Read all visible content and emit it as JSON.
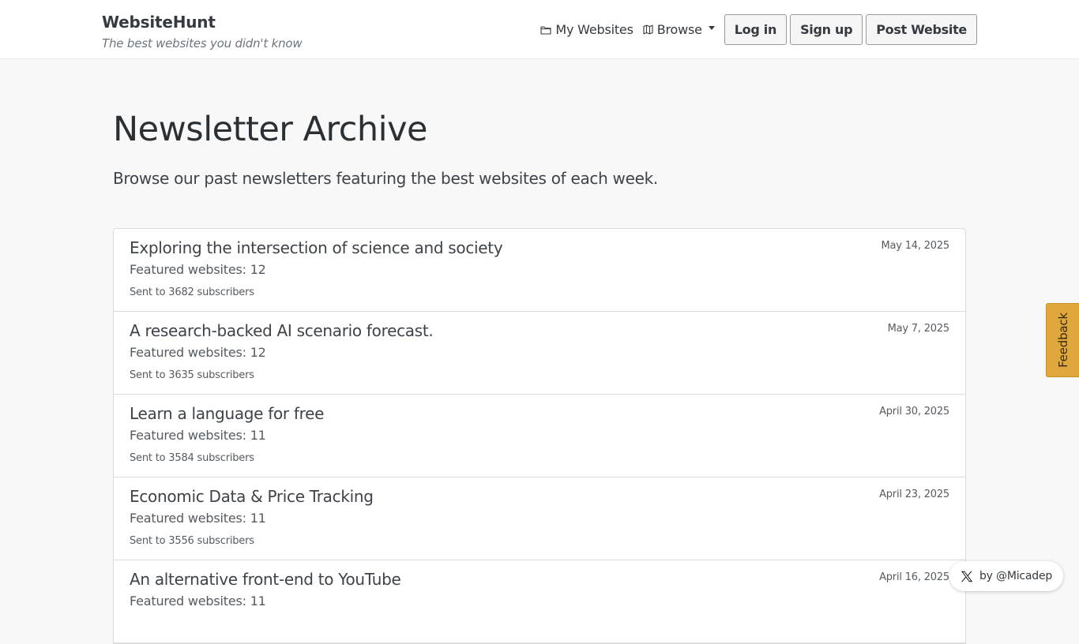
{
  "header": {
    "brand_title": "WebsiteHunt",
    "brand_tagline": "The best websites you didn't know",
    "nav": {
      "my_websites": "My Websites",
      "browse": "Browse"
    },
    "buttons": {
      "login": "Log in",
      "signup": "Sign up",
      "post_website": "Post Website"
    }
  },
  "main": {
    "title": "Newsletter Archive",
    "lead": "Browse our past newsletters featuring the best websites of each week.",
    "newsletters": [
      {
        "title": "Exploring the intersection of science and society",
        "featured": "Featured websites: 12",
        "subscribers": "Sent to 3682 subscribers",
        "date": "May 14, 2025"
      },
      {
        "title": "A research-backed AI scenario forecast.",
        "featured": "Featured websites: 12",
        "subscribers": "Sent to 3635 subscribers",
        "date": "May 7, 2025"
      },
      {
        "title": "Learn a language for free",
        "featured": "Featured websites: 11",
        "subscribers": "Sent to 3584 subscribers",
        "date": "April 30, 2025"
      },
      {
        "title": "Economic Data & Price Tracking",
        "featured": "Featured websites: 11",
        "subscribers": "Sent to 3556 subscribers",
        "date": "April 23, 2025"
      },
      {
        "title": "An alternative front-end to YouTube",
        "featured": "Featured websites: 11",
        "subscribers": "",
        "date": "April 16, 2025"
      }
    ]
  },
  "feedback": {
    "label": "Feedback",
    "color": "#e0a83c"
  },
  "badge": {
    "icon": "x-logo-icon",
    "text": "by @Micadep"
  },
  "icons": {
    "my_websites": "folder-icon",
    "browse": "map-icon",
    "browse_toggle": "caret-down-icon"
  }
}
